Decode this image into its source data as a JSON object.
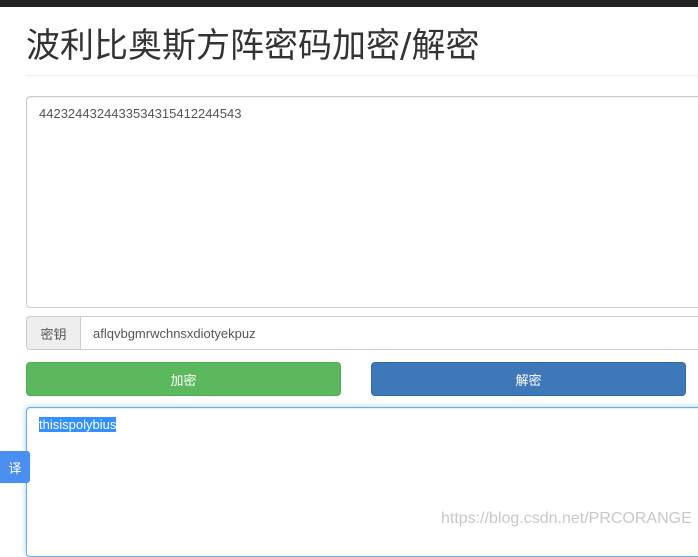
{
  "page": {
    "title": "波利比奥斯方阵密码加密/解密"
  },
  "input": {
    "value": "4423244324433534315412244543"
  },
  "key": {
    "label": "密钥",
    "value": "aflqvbgmrwchnsxdiotyekpuz"
  },
  "buttons": {
    "encrypt": "加密",
    "decrypt": "解密"
  },
  "output": {
    "value": "thisispolybius"
  },
  "side_tab": {
    "label": "译"
  },
  "watermark": {
    "text": "https://blog.csdn.net/PRCORANGE"
  },
  "colors": {
    "encrypt_button": "#5cb85c",
    "decrypt_button": "#3e78b8",
    "selection": "#3390ff",
    "focus_border": "#66afe9"
  }
}
